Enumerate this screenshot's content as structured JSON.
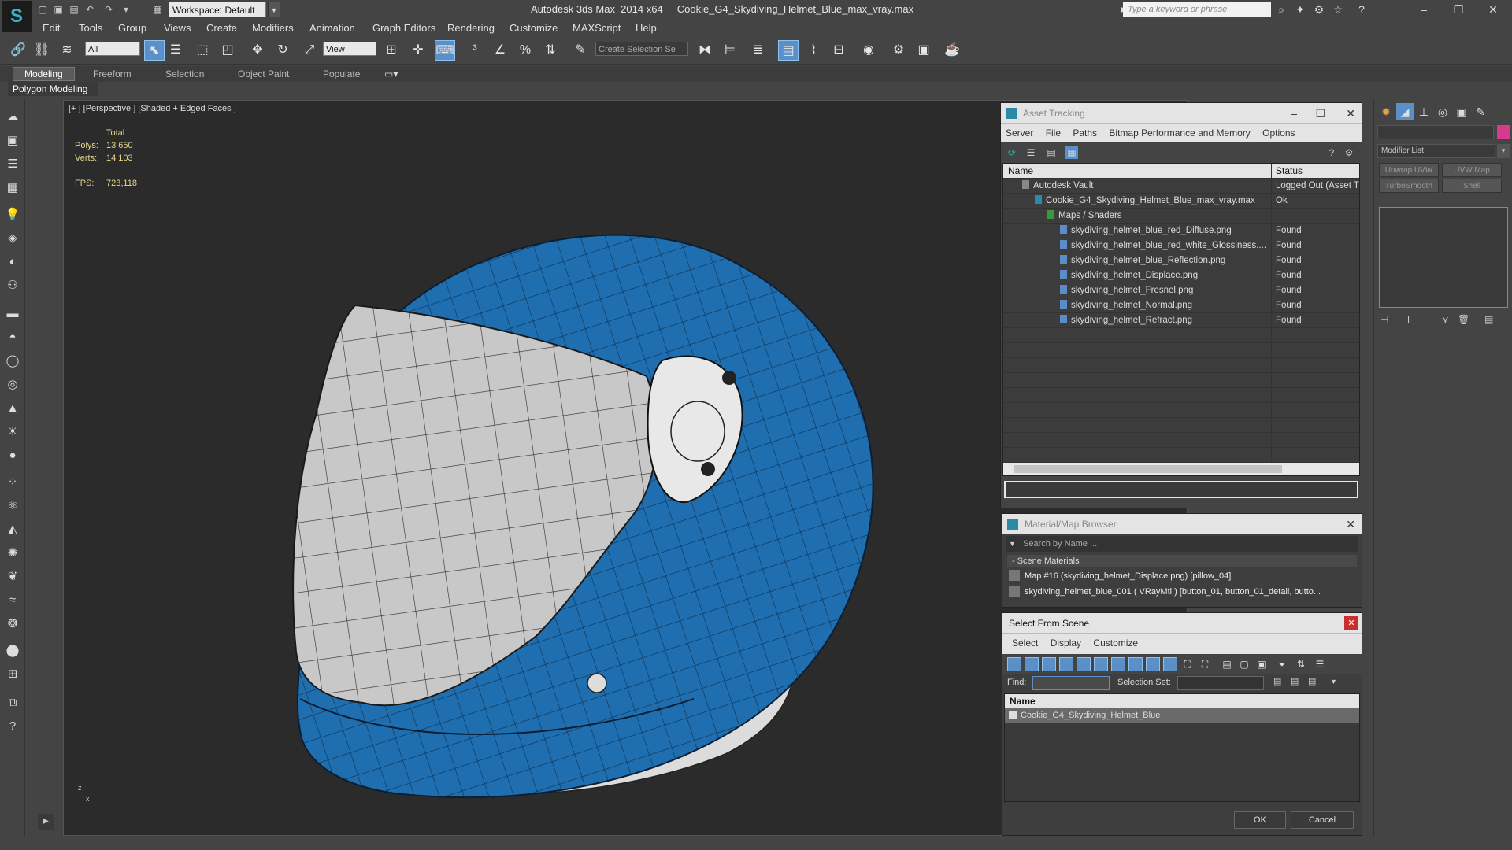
{
  "app": {
    "title": "Autodesk 3ds Max  2014 x64     Cookie_G4_Skydiving_Helmet_Blue_max_vray.max",
    "workspace": "Workspace: Default",
    "search_placeholder": "Type a keyword or phrase"
  },
  "menu": [
    "Edit",
    "Tools",
    "Group",
    "Views",
    "Create",
    "Modifiers",
    "Animation",
    "Graph Editors",
    "Rendering",
    "Customize",
    "MAXScript",
    "Help"
  ],
  "toolbar": {
    "filter": "All",
    "refcoord": "View",
    "selection_set": "Create Selection Se"
  },
  "ribbon": {
    "tabs": [
      "Modeling",
      "Freeform",
      "Selection",
      "Object Paint",
      "Populate"
    ],
    "active": "Modeling",
    "subpanel": "Polygon Modeling"
  },
  "viewport": {
    "label": "[+ ] [Perspective ] [Shaded + Edged Faces ]",
    "total_label": "Total",
    "polys_label": "Polys:",
    "polys": "13 650",
    "verts_label": "Verts:",
    "verts": "14 103",
    "fps_label": "FPS:",
    "fps": "723,118",
    "axis_z": "z",
    "axis_x": "x"
  },
  "asset_tracking": {
    "title": "Asset Tracking",
    "menu": [
      "Server",
      "File",
      "Paths",
      "Bitmap Performance and Memory",
      "Options"
    ],
    "col_name": "Name",
    "col_status": "Status",
    "rows": [
      {
        "name": "Autodesk Vault",
        "status": "Logged Out (Asset T",
        "indent": 1
      },
      {
        "name": "Cookie_G4_Skydiving_Helmet_Blue_max_vray.max",
        "status": "Ok",
        "indent": 2
      },
      {
        "name": "Maps / Shaders",
        "status": "",
        "indent": 3
      },
      {
        "name": "skydiving_helmet_blue_red_Diffuse.png",
        "status": "Found",
        "indent": 4
      },
      {
        "name": "skydiving_helmet_blue_red_white_Glossiness....",
        "status": "Found",
        "indent": 4
      },
      {
        "name": "skydiving_helmet_blue_Reflection.png",
        "status": "Found",
        "indent": 4
      },
      {
        "name": "skydiving_helmet_Displace.png",
        "status": "Found",
        "indent": 4
      },
      {
        "name": "skydiving_helmet_Fresnel.png",
        "status": "Found",
        "indent": 4
      },
      {
        "name": "skydiving_helmet_Normal.png",
        "status": "Found",
        "indent": 4
      },
      {
        "name": "skydiving_helmet_Refract.png",
        "status": "Found",
        "indent": 4
      }
    ]
  },
  "material_browser": {
    "title": "Material/Map Browser",
    "search_placeholder": "Search by Name ...",
    "section": "- Scene Materials",
    "items": [
      "Map #16 (skydiving_helmet_Displace.png) [pillow_04]",
      "skydiving_helmet_blue_001  ( VRayMtl ) [button_01, button_01_detail, butto..."
    ]
  },
  "select_from_scene": {
    "title": "Select From Scene",
    "menu": [
      "Select",
      "Display",
      "Customize"
    ],
    "find_label": "Find:",
    "selset_label": "Selection Set:",
    "col_name": "Name",
    "item": "Cookie_G4_Skydiving_Helmet_Blue",
    "ok": "OK",
    "cancel": "Cancel"
  },
  "command_panel": {
    "modifier_list": "Modifier List",
    "buttons": [
      "Unwrap UVW",
      "UVW Map",
      "TurboSmooth",
      "Shell"
    ],
    "color_swatch": "#d63a8a"
  },
  "colors": {
    "helmet_blue": "#1f6fb0",
    "visor_gray": "#c8c8c8",
    "accent": "#5a8fc8"
  }
}
